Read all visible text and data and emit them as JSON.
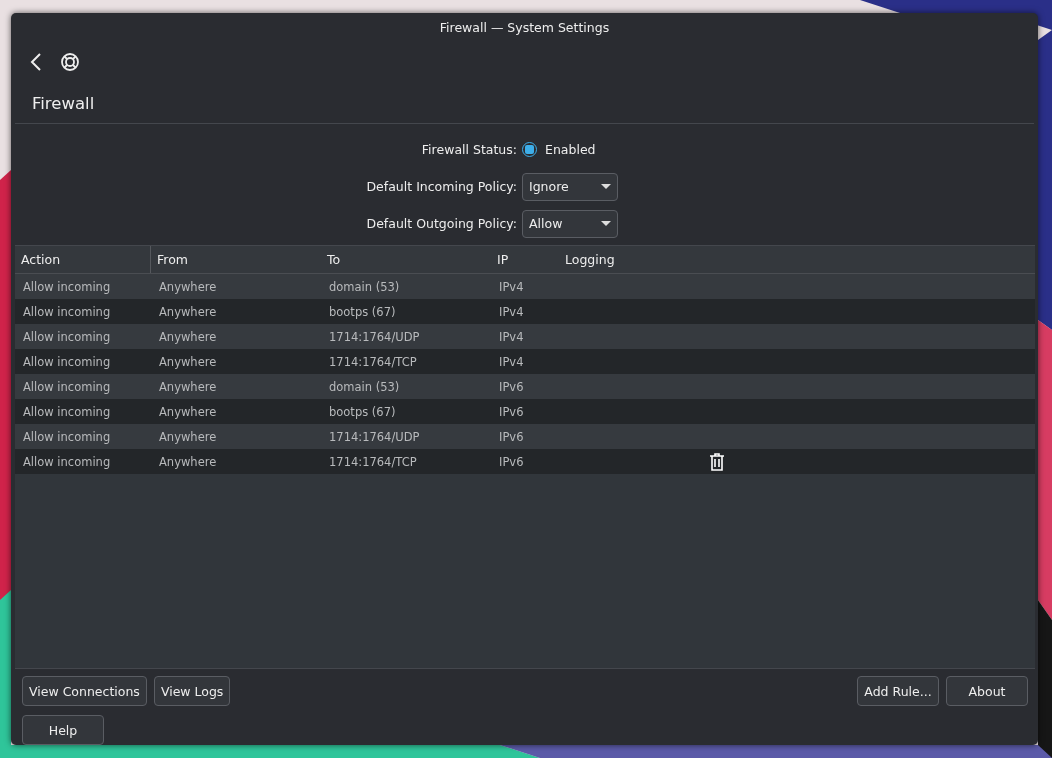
{
  "window": {
    "title": "Firewall — System Settings"
  },
  "page": {
    "title": "Firewall"
  },
  "status": {
    "label": "Firewall Status:",
    "checked": true,
    "text": "Enabled"
  },
  "policies": [
    {
      "label": "Default Incoming Policy:",
      "value": "Ignore"
    },
    {
      "label": "Default Outgoing Policy:",
      "value": "Allow"
    }
  ],
  "table": {
    "columns": [
      "Action",
      "From",
      "To",
      "IP",
      "Logging"
    ],
    "rows": [
      {
        "action": "Allow incoming",
        "from": "Anywhere",
        "to": "domain (53)",
        "ip": "IPv4",
        "hovered": false
      },
      {
        "action": "Allow incoming",
        "from": "Anywhere",
        "to": "bootps (67)",
        "ip": "IPv4",
        "hovered": false
      },
      {
        "action": "Allow incoming",
        "from": "Anywhere",
        "to": "1714:1764/UDP",
        "ip": "IPv4",
        "hovered": false
      },
      {
        "action": "Allow incoming",
        "from": "Anywhere",
        "to": "1714:1764/TCP",
        "ip": "IPv4",
        "hovered": false
      },
      {
        "action": "Allow incoming",
        "from": "Anywhere",
        "to": "domain (53)",
        "ip": "IPv6",
        "hovered": false
      },
      {
        "action": "Allow incoming",
        "from": "Anywhere",
        "to": "bootps (67)",
        "ip": "IPv6",
        "hovered": false
      },
      {
        "action": "Allow incoming",
        "from": "Anywhere",
        "to": "1714:1764/UDP",
        "ip": "IPv6",
        "hovered": false
      },
      {
        "action": "Allow incoming",
        "from": "Anywhere",
        "to": "1714:1764/TCP",
        "ip": "IPv6",
        "hovered": true
      }
    ]
  },
  "buttons_left": [
    "View Connections",
    "View Logs"
  ],
  "buttons_right": [
    "Add Rule...",
    "About"
  ],
  "help_button": "Help"
}
